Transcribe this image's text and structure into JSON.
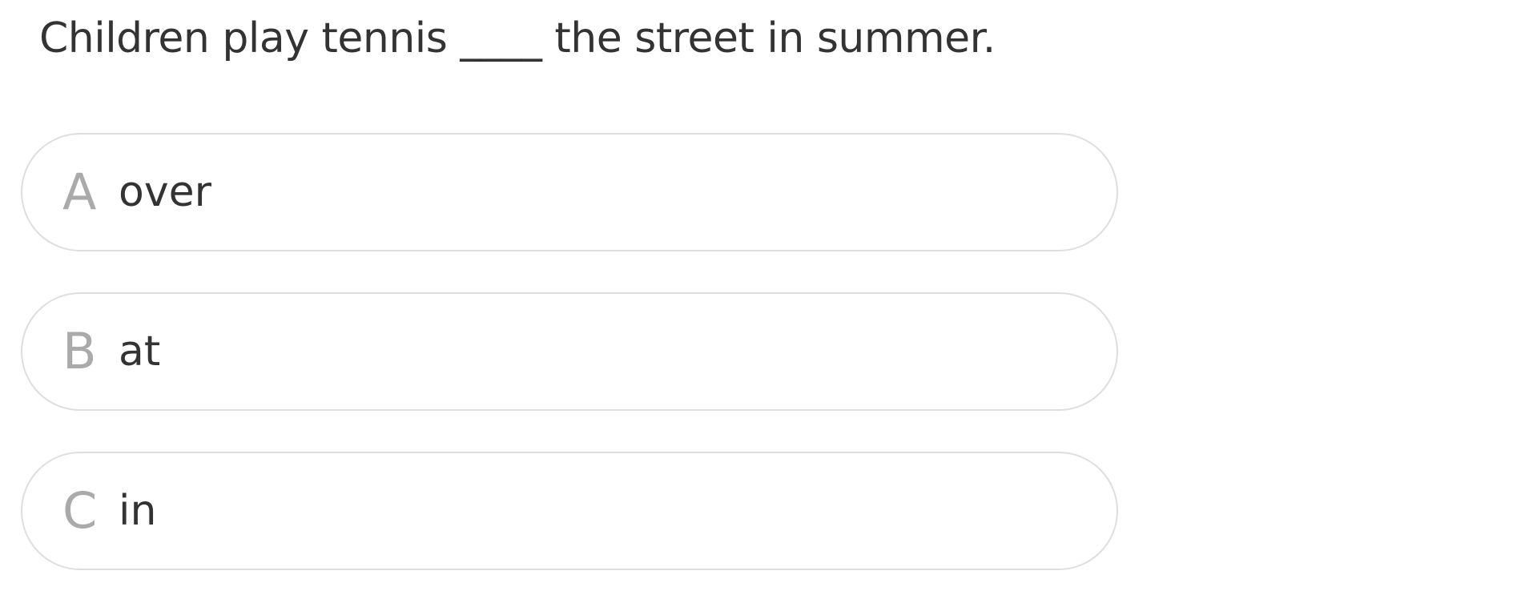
{
  "question": {
    "text": "Children play tennis ____ the street in summer."
  },
  "options": [
    {
      "letter": "A",
      "text": "over"
    },
    {
      "letter": "B",
      "text": "at"
    },
    {
      "letter": "C",
      "text": "in"
    }
  ]
}
